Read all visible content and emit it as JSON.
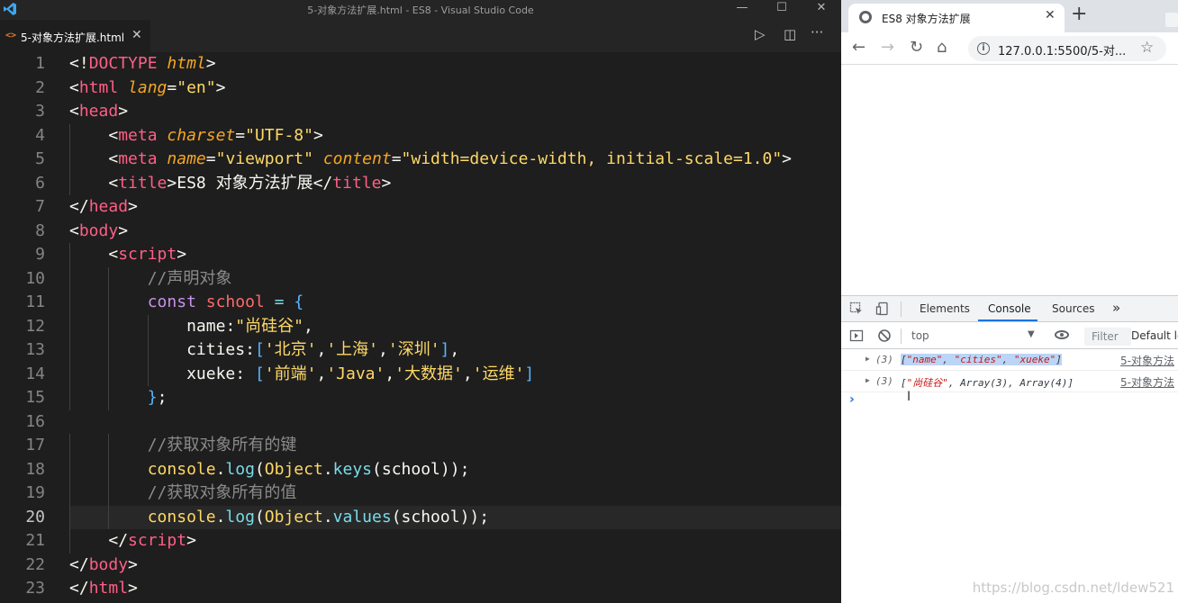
{
  "vscode": {
    "window_title": "5-对象方法扩展.html - ES8 - Visual Studio Code",
    "tab_label": "5-对象方法扩展.html",
    "tab_icon": "<>",
    "controls": {
      "minimize": "—",
      "maximize": "☐",
      "close": "✕"
    },
    "actions": {
      "run": "▷",
      "split": "◫",
      "more": "···"
    },
    "current_line": 20,
    "lines": [
      {
        "n": "1"
      },
      {
        "n": "2"
      },
      {
        "n": "3"
      },
      {
        "n": "4"
      },
      {
        "n": "5"
      },
      {
        "n": "6"
      },
      {
        "n": "7"
      },
      {
        "n": "8"
      },
      {
        "n": "9"
      },
      {
        "n": "10"
      },
      {
        "n": "11"
      },
      {
        "n": "12"
      },
      {
        "n": "13"
      },
      {
        "n": "14"
      },
      {
        "n": "15"
      },
      {
        "n": "16"
      },
      {
        "n": "17"
      },
      {
        "n": "18"
      },
      {
        "n": "19"
      },
      {
        "n": "20"
      },
      {
        "n": "21"
      },
      {
        "n": "22"
      },
      {
        "n": "23"
      }
    ],
    "code": {
      "l1": [
        "<!",
        "DOCTYPE",
        " ",
        "html",
        ">"
      ],
      "l2": [
        "<",
        "html",
        " ",
        "lang",
        "=",
        "\"en\"",
        ">"
      ],
      "l3": [
        "<",
        "head",
        ">"
      ],
      "l4": [
        "<",
        "meta",
        " ",
        "charset",
        "=",
        "\"UTF-8\"",
        ">"
      ],
      "l5": [
        "<",
        "meta",
        " ",
        "name",
        "=",
        "\"viewport\"",
        " ",
        "content",
        "=",
        "\"width=device-width, initial-scale=1.0\"",
        ">"
      ],
      "l6": [
        "<",
        "title",
        ">",
        "ES8 对象方法扩展",
        "</",
        "title",
        ">"
      ],
      "l7": [
        "</",
        "head",
        ">"
      ],
      "l8": [
        "<",
        "body",
        ">"
      ],
      "l9": [
        "<",
        "script",
        ">"
      ],
      "l10": [
        "//声明对象"
      ],
      "l11": [
        "const",
        " ",
        "school",
        " ",
        "=",
        " ",
        "{"
      ],
      "l12": [
        "name",
        ":",
        "\"尚硅谷\"",
        ","
      ],
      "l13": [
        "cities",
        ":",
        "[",
        "'北京'",
        ",",
        "'上海'",
        ",",
        "'深圳'",
        "]",
        ","
      ],
      "l14": [
        "xueke",
        ": ",
        "[",
        "'前端'",
        ",",
        "'Java'",
        ",",
        "'大数据'",
        ",",
        "'运维'",
        "]"
      ],
      "l15": [
        "}",
        ";"
      ],
      "l16": [],
      "l17": [
        "//获取对象所有的键"
      ],
      "l18": [
        "console",
        ".",
        "log",
        "(",
        "Object",
        ".",
        "keys",
        "(",
        "school",
        "))",
        ";"
      ],
      "l19": [
        "//获取对象所有的值"
      ],
      "l20": [
        "console",
        ".",
        "log",
        "(",
        "Object",
        ".",
        "values",
        "(",
        "school",
        "))",
        ";"
      ],
      "l21": [
        "</",
        "script",
        ">"
      ],
      "l22": [
        "</",
        "body",
        ">"
      ],
      "l23": [
        "</",
        "html",
        ">"
      ]
    }
  },
  "browser": {
    "tab_title": "ES8 对象方法扩展",
    "tab_close": "✕",
    "new_tab": "+",
    "url": "127.0.0.1:5500/5-对...",
    "nav": {
      "back": "←",
      "forward": "→",
      "reload": "↻",
      "home": "⌂"
    },
    "star": "☆",
    "devtools": {
      "tabs": [
        "Elements",
        "Console",
        "Sources"
      ],
      "active_tab": "Console",
      "more_tabs": "»",
      "context": "top",
      "context_arrow": "▼",
      "filter_placeholder": "Filter",
      "levels": "Default le",
      "logs": [
        {
          "count": "(3)",
          "expand": "▶",
          "open": "[",
          "items": [
            "\"name\"",
            "\"cities\"",
            "\"xueke\""
          ],
          "sep": ", ",
          "close": "]",
          "source": "5-对象方法"
        },
        {
          "count": "(3)",
          "expand": "▶",
          "open": "[",
          "items": [
            "\"尚硅谷\"",
            "Array(3)",
            "Array(4)"
          ],
          "sep": ", ",
          "close": "]",
          "source": "5-对象方法"
        }
      ],
      "prompt": "›",
      "cursor": "I"
    }
  },
  "watermark": "https://blog.csdn.net/ldew521"
}
